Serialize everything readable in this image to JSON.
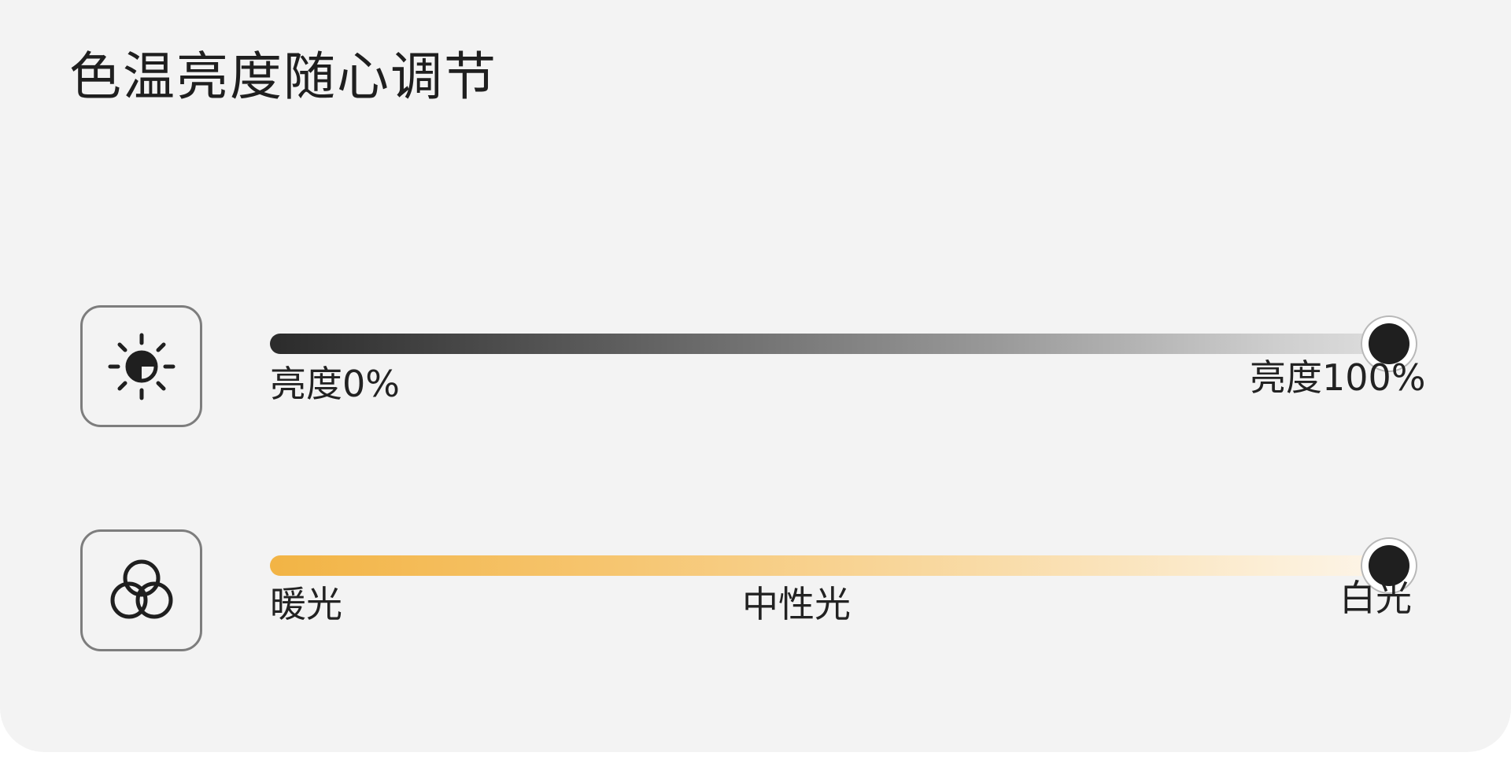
{
  "header": {
    "title": "色温亮度随心调节"
  },
  "brightness": {
    "icon": "brightness-icon",
    "min_label": "亮度0%",
    "max_label": "亮度100%",
    "value_percent": 100
  },
  "color_temperature": {
    "icon": "color-blend-icon",
    "warm_label": "暖光",
    "neutral_label": "中性光",
    "white_label": "白光",
    "value_fraction": 1.0
  },
  "colors": {
    "background": "#f3f3f3",
    "warm": "#f2b445",
    "knob": "#1f1f1f"
  }
}
